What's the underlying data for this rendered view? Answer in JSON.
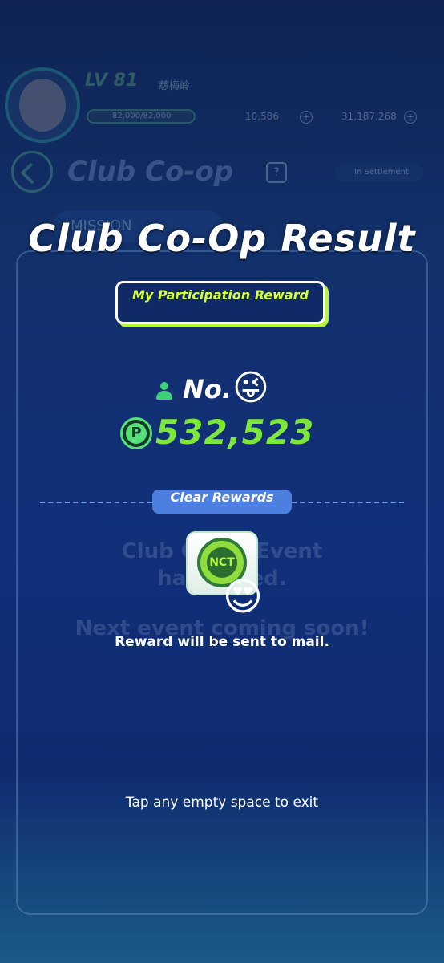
{
  "background": {
    "player_level": "LV 81",
    "player_name": "慈梅岭",
    "xp": "82,000/82,000",
    "gems": "10,586",
    "coins": "31,187,268",
    "screen_title": "Club Co-op",
    "help_label": "?",
    "settlement_label": "In Settlement",
    "mission_tab": "MISSION",
    "event_line1": "Club Co-op Event",
    "event_line2": "has ended.",
    "event_line3": "Next event coming soon!"
  },
  "result": {
    "title": "Club Co-Op Result",
    "participation_label": "My Participation Reward",
    "rank_prefix": "No.",
    "rank_emoji": "😜",
    "points": "532,523",
    "points_icon": "P",
    "clear_rewards_label": "Clear Rewards",
    "reward_badge_text": "NCT",
    "reward_emoji": "😍",
    "mail_notice": "Reward will be sent to mail.",
    "exit_hint": "Tap any empty space to exit"
  },
  "colors": {
    "accent_green": "#7ee83a",
    "reward_yellow": "#d8ff3a",
    "pill_blue": "#4d7fe0"
  }
}
